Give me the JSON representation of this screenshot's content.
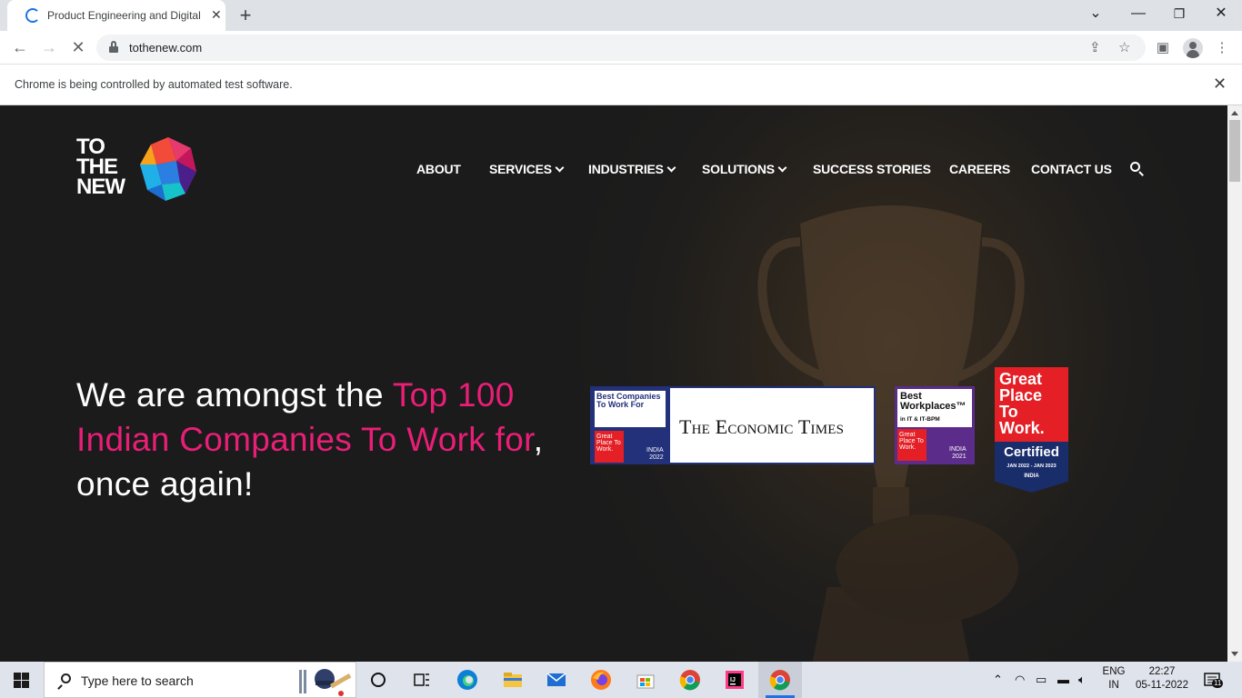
{
  "browser": {
    "tab_title": "Product Engineering and Digital T",
    "url": "tothenew.com",
    "infobar_text": "Chrome is being controlled by automated test software."
  },
  "site": {
    "logo_lines": [
      "TO",
      "THE",
      "NEW"
    ],
    "nav": {
      "about": "ABOUT",
      "services": "SERVICES",
      "industries": "INDUSTRIES",
      "solutions": "SOLUTIONS",
      "success_stories": "SUCCESS STORIES",
      "careers": "CAREERS",
      "contact_us": "CONTACT US"
    },
    "headline": {
      "part1": "We are amongst the ",
      "highlight": "Top 100 Indian Companies To Work for",
      "part2": ", once again!"
    },
    "badges": {
      "et_top": "Best Companies To Work For",
      "et_gptw": "Great Place To Work.",
      "et_india": "INDIA",
      "et_year": "2022",
      "et_name": "The Economic Times",
      "bw_title": "Best Workplaces™",
      "bw_sub": "in IT & IT-BPM",
      "bw_gptw": "Great Place To Work.",
      "bw_india": "INDIA",
      "bw_year": "2021",
      "gp_lines": [
        "Great",
        "Place",
        "To",
        "Work."
      ],
      "gp_cert": "Certified",
      "gp_date": "JAN 2022 - JAN 2023",
      "gp_india": "INDIA"
    },
    "colors": {
      "accent": "#e91e77",
      "page_bg": "#1c1c1c"
    }
  },
  "taskbar": {
    "search_placeholder": "Type here to search",
    "lang1": "ENG",
    "lang2": "IN",
    "time": "22:27",
    "date": "05-11-2022",
    "notifications": "11"
  }
}
